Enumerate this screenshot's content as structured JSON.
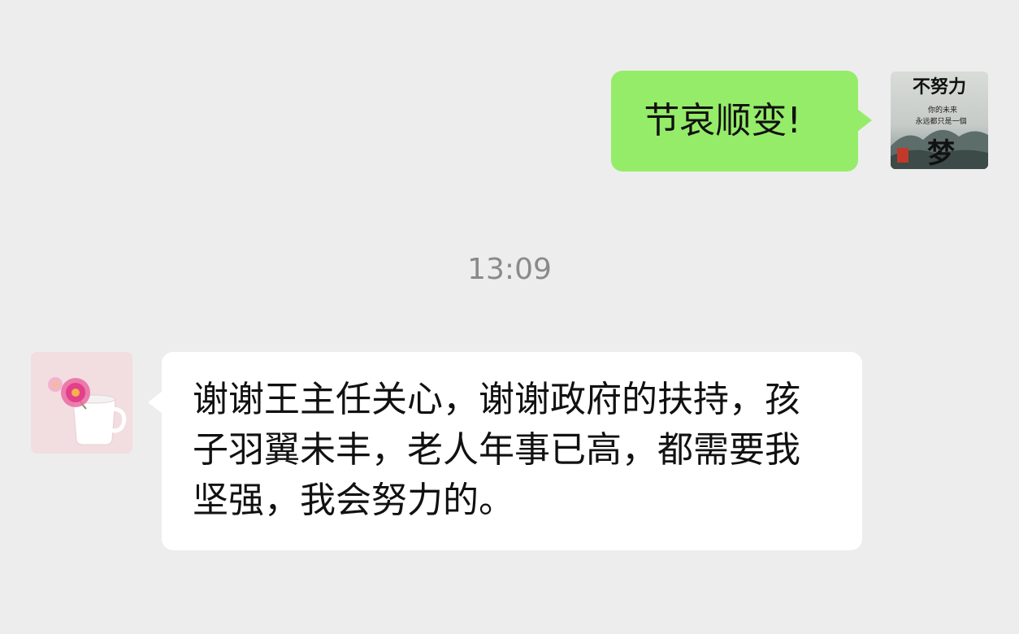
{
  "conversation": {
    "outgoing": {
      "text": "节哀顺变!",
      "avatar": {
        "icon": "motivational-calligraphy-avatar",
        "title": "不努力",
        "subtitle_line1": "你的未来",
        "subtitle_line2": "永远都只是一個",
        "big_char": "梦"
      }
    },
    "timestamp": "13:09",
    "incoming": {
      "text": "谢谢王主任关心，谢谢政府的扶持，孩子羽翼未丰，老人年事已高，都需要我坚强，我会努力的。",
      "avatar": {
        "icon": "flower-in-cup-avatar"
      }
    }
  },
  "colors": {
    "background": "#ededed",
    "outgoing_bubble": "#95ec69",
    "incoming_bubble": "#ffffff",
    "timestamp": "#8a8a8a"
  }
}
